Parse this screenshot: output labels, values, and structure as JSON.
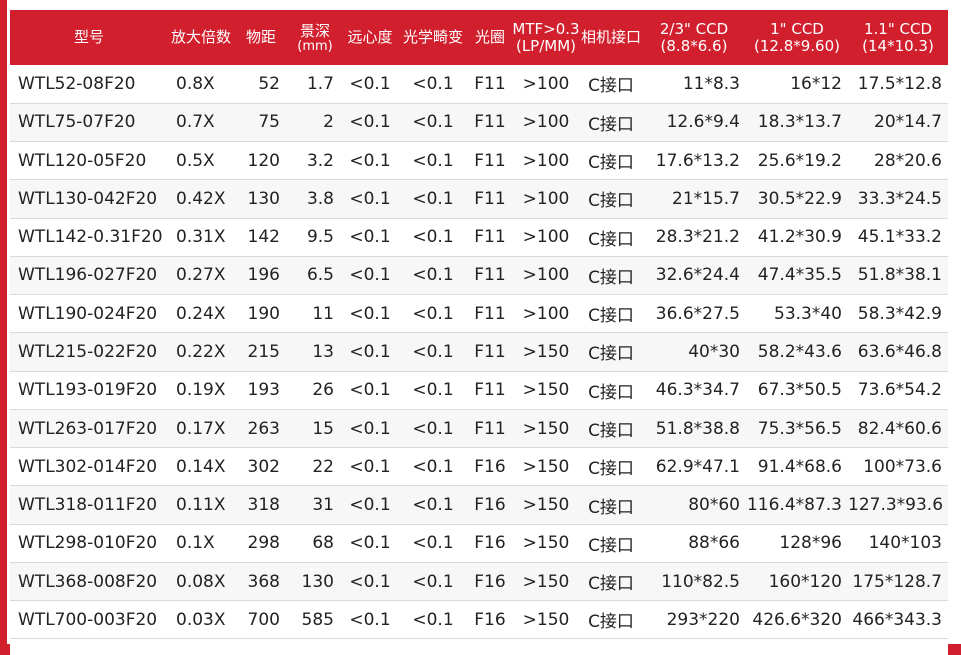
{
  "theme": {
    "accent": "#d21f2e",
    "header_text": "#ffffff",
    "body_text": "#222222"
  },
  "header": {
    "model": "型号",
    "magnification": "放大倍数",
    "working_distance": "物距",
    "depth_of_field": "景深",
    "depth_of_field_unit": "(mm)",
    "telecentricity": "远心度",
    "distortion": "光学畸变",
    "aperture": "光圈",
    "mtf_line1": "MTF>0.3",
    "mtf_line2": "(LP/MM)",
    "mount": "相机接口",
    "ccd_23_line1": "2/3\" CCD",
    "ccd_23_line2": "(8.8*6.6)",
    "ccd_1_line1": "1\" CCD",
    "ccd_1_line2": "(12.8*9.60)",
    "ccd_11_line1": "1.1\" CCD",
    "ccd_11_line2": "(14*10.3)"
  },
  "rows": [
    [
      "WTL52-08F20",
      "0.8X",
      "52",
      "1.7",
      "<0.1",
      "<0.1",
      "F11",
      ">100",
      "C接口",
      "11*8.3",
      "16*12",
      "17.5*12.8"
    ],
    [
      "WTL75-07F20",
      "0.7X",
      "75",
      "2",
      "<0.1",
      "<0.1",
      "F11",
      ">100",
      "C接口",
      "12.6*9.4",
      "18.3*13.7",
      "20*14.7"
    ],
    [
      "WTL120-05F20",
      "0.5X",
      "120",
      "3.2",
      "<0.1",
      "<0.1",
      "F11",
      ">100",
      "C接口",
      "17.6*13.2",
      "25.6*19.2",
      "28*20.6"
    ],
    [
      "WTL130-042F20",
      "0.42X",
      "130",
      "3.8",
      "<0.1",
      "<0.1",
      "F11",
      ">100",
      "C接口",
      "21*15.7",
      "30.5*22.9",
      "33.3*24.5"
    ],
    [
      "WTL142-0.31F20",
      "0.31X",
      "142",
      "9.5",
      "<0.1",
      "<0.1",
      "F11",
      ">100",
      "C接口",
      "28.3*21.2",
      "41.2*30.9",
      "45.1*33.2"
    ],
    [
      "WTL196-027F20",
      "0.27X",
      "196",
      "6.5",
      "<0.1",
      "<0.1",
      "F11",
      ">100",
      "C接口",
      "32.6*24.4",
      "47.4*35.5",
      "51.8*38.1"
    ],
    [
      "WTL190-024F20",
      "0.24X",
      "190",
      "11",
      "<0.1",
      "<0.1",
      "F11",
      ">100",
      "C接口",
      "36.6*27.5",
      "53.3*40",
      "58.3*42.9"
    ],
    [
      "WTL215-022F20",
      "0.22X",
      "215",
      "13",
      "<0.1",
      "<0.1",
      "F11",
      ">150",
      "C接口",
      "40*30",
      "58.2*43.6",
      "63.6*46.8"
    ],
    [
      "WTL193-019F20",
      "0.19X",
      "193",
      "26",
      "<0.1",
      "<0.1",
      "F11",
      ">150",
      "C接口",
      "46.3*34.7",
      "67.3*50.5",
      "73.6*54.2"
    ],
    [
      "WTL263-017F20",
      "0.17X",
      "263",
      "15",
      "<0.1",
      "<0.1",
      "F11",
      ">150",
      "C接口",
      "51.8*38.8",
      "75.3*56.5",
      "82.4*60.6"
    ],
    [
      "WTL302-014F20",
      "0.14X",
      "302",
      "22",
      "<0.1",
      "<0.1",
      "F16",
      ">150",
      "C接口",
      "62.9*47.1",
      "91.4*68.6",
      "100*73.6"
    ],
    [
      "WTL318-011F20",
      "0.11X",
      "318",
      "31",
      "<0.1",
      "<0.1",
      "F16",
      ">150",
      "C接口",
      "80*60",
      "116.4*87.3",
      "127.3*93.6"
    ],
    [
      "WTL298-010F20",
      "0.1X",
      "298",
      "68",
      "<0.1",
      "<0.1",
      "F16",
      ">150",
      "C接口",
      "88*66",
      "128*96",
      "140*103"
    ],
    [
      "WTL368-008F20",
      "0.08X",
      "368",
      "130",
      "<0.1",
      "<0.1",
      "F16",
      ">150",
      "C接口",
      "110*82.5",
      "160*120",
      "175*128.7"
    ],
    [
      "WTL700-003F20",
      "0.03X",
      "700",
      "585",
      "<0.1",
      "<0.1",
      "F16",
      ">150",
      "C接口",
      "293*220",
      "426.6*320",
      "466*343.3"
    ]
  ]
}
